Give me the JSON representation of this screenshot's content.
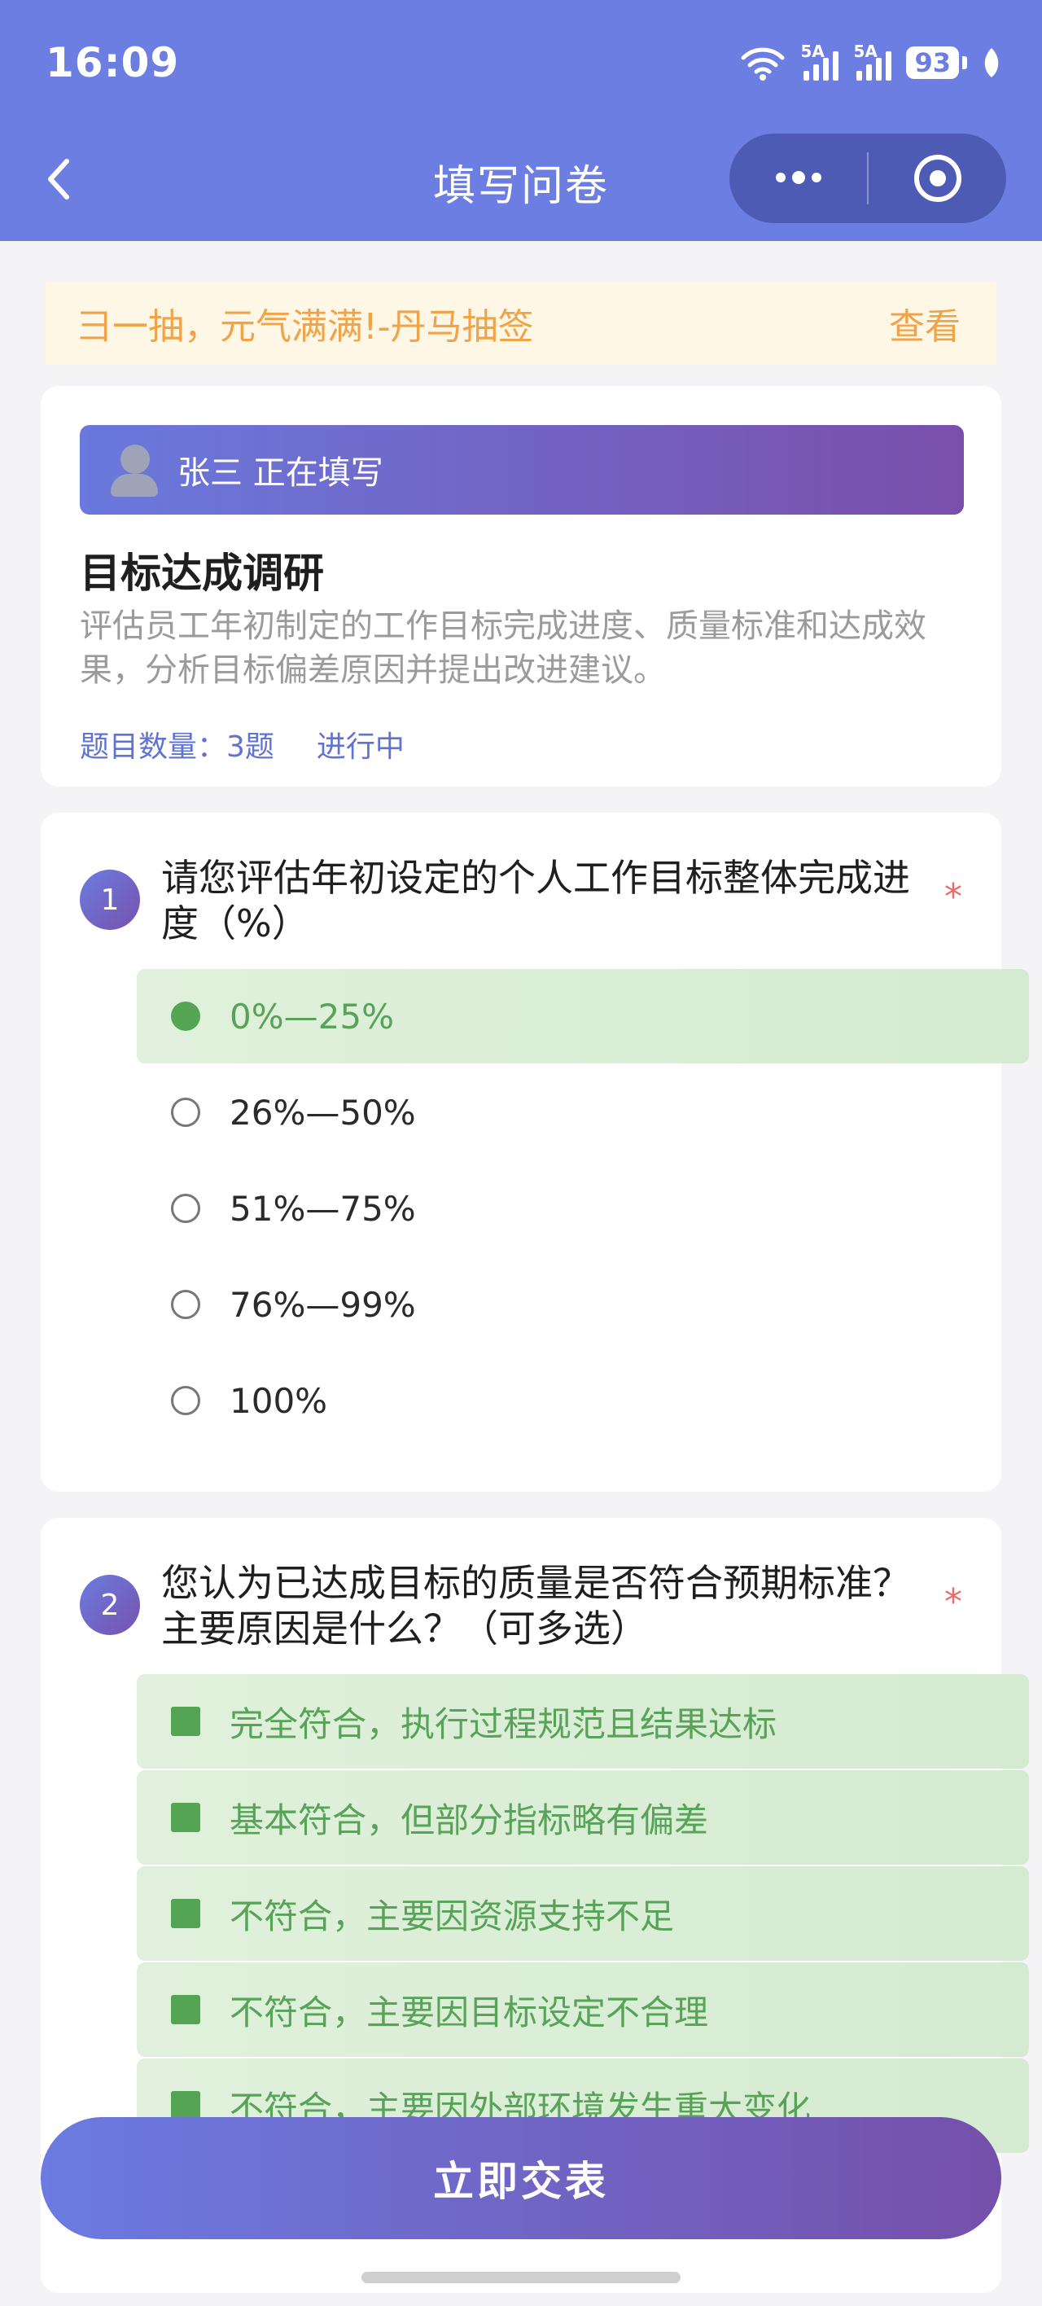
{
  "status_bar": {
    "time": "16:09",
    "sig1": "5A",
    "sig2": "5A",
    "battery": "93"
  },
  "nav": {
    "title": "填写问卷"
  },
  "notice": {
    "text": "彐一抽，元气满满!-丹马抽签",
    "action": "查看"
  },
  "survey": {
    "filler": "张三 正在填写",
    "title": "目标达成调研",
    "description": "评估员工年初制定的工作目标完成进度、质量标准和达成效果，分析目标偏差原因并提出改进建议。",
    "count": "题目数量：3题",
    "state": "进行中"
  },
  "questions": [
    {
      "num": "1",
      "text": "请您评估年初设定的个人工作目标整体完成进度（%）",
      "required": "*",
      "options": [
        {
          "label": "0%—25%",
          "selected": true
        },
        {
          "label": "26%—50%",
          "selected": false
        },
        {
          "label": "51%—75%",
          "selected": false
        },
        {
          "label": "76%—99%",
          "selected": false
        },
        {
          "label": "100%",
          "selected": false
        }
      ]
    },
    {
      "num": "2",
      "text": "您认为已达成目标的质量是否符合预期标准？主要原因是什么？（可多选）",
      "required": "*",
      "options": [
        {
          "label": "完全符合，执行过程规范且结果达标",
          "selected": true
        },
        {
          "label": "基本符合，但部分指标略有偏差",
          "selected": true
        },
        {
          "label": "不符合，主要因资源支持不足",
          "selected": true
        },
        {
          "label": "不符合，主要因目标设定不合理",
          "selected": true
        },
        {
          "label": "不符合，主要因外部环境发生重大变化",
          "selected": true
        }
      ]
    }
  ],
  "submit": {
    "label": "立即交表"
  },
  "colors": {
    "primary": "#6c7ee1",
    "accent_green": "#53a553",
    "notice_text": "#f0a347",
    "required": "#ea6a6a"
  }
}
